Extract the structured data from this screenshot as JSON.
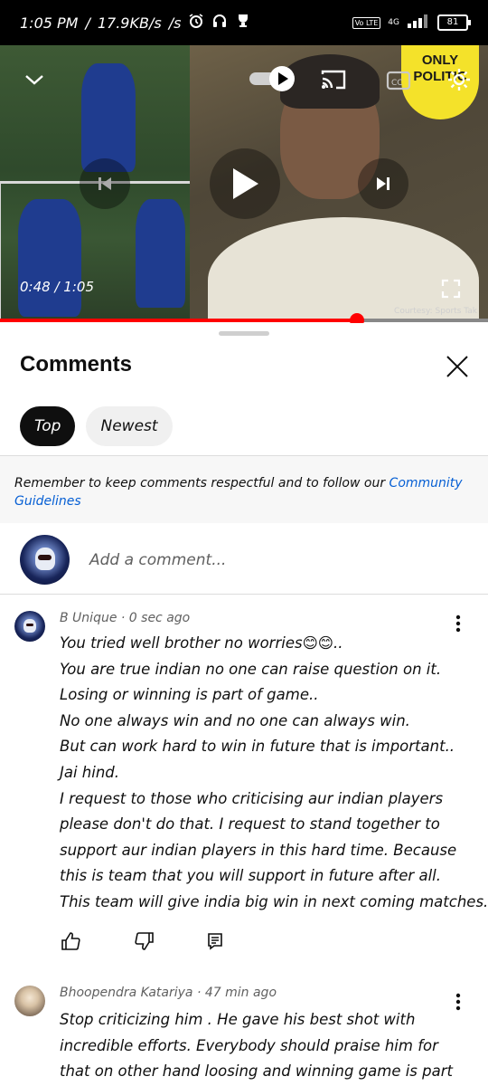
{
  "status_bar": {
    "time": "1:05 PM",
    "speed": "17.9KB/s",
    "battery": "81",
    "volte": "Vo LTE",
    "network": "4G"
  },
  "player": {
    "time_current": "0:48",
    "time_total": "1:05",
    "progress_fraction": 0.731,
    "logo_text_1": "ONLY",
    "logo_text_2": "POLITIC",
    "courtesy": "Courtesy: Sports Tak"
  },
  "comments_sheet": {
    "title": "Comments",
    "tabs": [
      {
        "label": "Top",
        "active": true
      },
      {
        "label": "Newest",
        "active": false
      }
    ],
    "notice_text": "Remember to keep comments respectful and to follow our ",
    "notice_link": "Community Guidelines",
    "add_placeholder": "Add a comment..."
  },
  "comments": [
    {
      "author": "B Unique",
      "age": "0 sec ago",
      "lines": [
        "You tried well brother no worries😊😊..",
        "You are true indian no one can raise question on it.",
        "Losing or winning is part of game..",
        "No one always win and no one can always win.",
        "But can work hard to win in future that is important..",
        "Jai hind.",
        "I request to those who criticising aur indian players",
        "please don't do that. I request to stand together to",
        "support aur indian players in this hard time. Because",
        "this is team that you will support in future after all.",
        "This team will give india big win in next coming matches."
      ]
    },
    {
      "author": "Bhoopendra Katariya",
      "age": "47 min ago",
      "lines": [
        "Stop criticizing him . He gave his best shot with",
        "incredible efforts. Everybody should praise him for",
        "that on other hand loosing and winning game is part"
      ]
    }
  ],
  "colors": {
    "accent_red": "#ff0000",
    "link_blue": "#065fd4",
    "chip_active": "#0f0f0f",
    "chip_inactive": "#f0f0f0"
  }
}
